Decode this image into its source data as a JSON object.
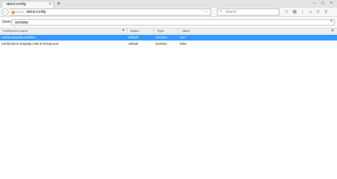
{
  "tab": {
    "title": "about:config",
    "close_glyph": "×",
    "new_tab_glyph": "+"
  },
  "window": {
    "minimize": "–",
    "maximize": "□",
    "close": "×"
  },
  "navbar": {
    "back_glyph": "←",
    "brand_label": "Firefox",
    "url": "about:config",
    "go_glyph": "→",
    "search_placeholder": "Search",
    "search_glyph": "⌕",
    "icons": [
      {
        "name": "bookmark-star-icon",
        "glyph": "☆"
      },
      {
        "name": "library-icon",
        "glyph": "▤"
      },
      {
        "name": "download-icon",
        "glyph": "↓"
      },
      {
        "name": "home-icon",
        "glyph": "⌂"
      },
      {
        "name": "smiley-icon",
        "glyph": "☺"
      },
      {
        "name": "menu-icon",
        "glyph": "≡"
      }
    ]
  },
  "filter": {
    "label": "Search:",
    "value": "autoplay",
    "icon_glyph": "⌕"
  },
  "table": {
    "columns": [
      "Preference Name",
      "Status",
      "Type",
      "Value"
    ],
    "sort_glyph": "▼",
    "col_picker_glyph": "⊞",
    "rows": [
      {
        "name": "media.autoplay.enabled",
        "status": "default",
        "type": "boolean",
        "value": "true",
        "selected": true
      },
      {
        "name": "media.block-autoplay-until-in-foreground",
        "status": "default",
        "type": "boolean",
        "value": "false",
        "selected": false
      }
    ]
  },
  "colors": {
    "selection": "#3399ff",
    "firefox_logo": "#f29f1c"
  }
}
